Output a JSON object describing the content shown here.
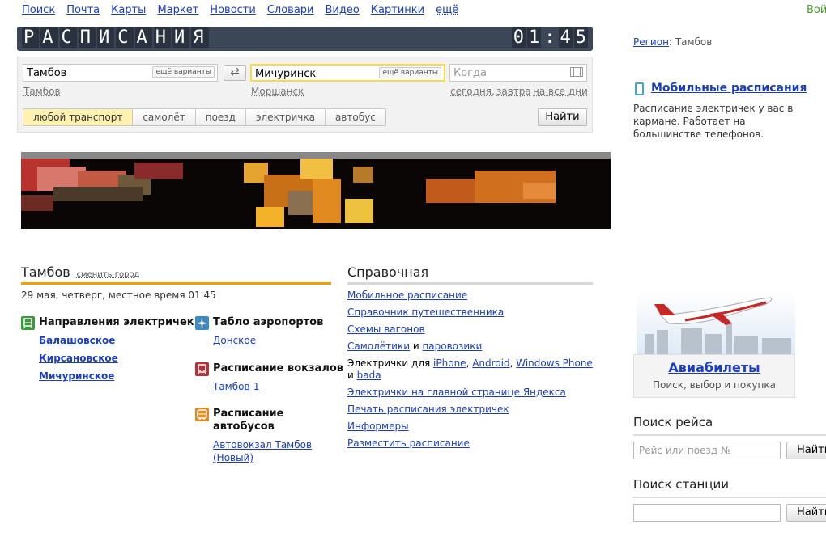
{
  "topnav": {
    "items": [
      "Поиск",
      "Почта",
      "Карты",
      "Маркет",
      "Новости",
      "Словари",
      "Видео",
      "Картинки"
    ],
    "more": "ещё",
    "login": "Вой"
  },
  "header": {
    "title": "РАСПИСАНИЯ",
    "clock": "01:45"
  },
  "form": {
    "from_value": "Тамбов",
    "to_value": "Мичуринск",
    "variants_label": "ещё варианты",
    "when_placeholder": "Когда",
    "from_hint": "Тамбов",
    "to_hint": "Моршанск",
    "date_hints": [
      "сегодня",
      "завтра",
      "на все дни"
    ],
    "transport_tabs": [
      "любой транспорт",
      "самолёт",
      "поезд",
      "электричка",
      "автобус"
    ],
    "find_button": "Найти"
  },
  "city": {
    "name": "Тамбов",
    "change_link": "сменить город",
    "date_line": "29 мая, четверг, местное время 01 45"
  },
  "sections": {
    "trains": {
      "title": "Направления электричек",
      "items": [
        "Балашовское",
        "Кирсановское",
        "Мичуринское"
      ]
    },
    "airports": {
      "title": "Табло аэропортов",
      "items": [
        "Донское"
      ]
    },
    "stations": {
      "title": "Расписание вокзалов",
      "items": [
        "Тамбов-1"
      ]
    },
    "buses": {
      "title_line1": "Расписание",
      "title_line2": "автобусов",
      "item_line1": "Автовокзал Тамбов",
      "item_line2": "(Новый)"
    }
  },
  "reference": {
    "title": "Справочная",
    "links": [
      "Мобильное расписание",
      "Справочник путешественника",
      "Схемы вагонов"
    ],
    "planes_and": {
      "a": "Самолётики",
      "and": " и ",
      "b": "паровозики"
    },
    "apps": {
      "prefix": "Электрички для ",
      "iphone": "iPhone",
      "android": "Android",
      "wp": "Windows Phone",
      "and": " и ",
      "bada": "bada"
    },
    "links2": [
      "Электрички на главной странице Яндекса",
      "Печать расписания электричек",
      "Информеры",
      "Разместить расписание"
    ]
  },
  "right": {
    "region_label": "Регион",
    "region_value": ": Тамбов",
    "mobile_title": "Мобильные расписания",
    "mobile_text": "Расписание электричек у вас в кармане. Работает на большинстве телефонов.",
    "avia_title": "Авиабилеты",
    "avia_sub": "Поиск, выбор и покупка",
    "trip_search_title": "Поиск рейса",
    "trip_search_placeholder": "Рейс или поезд №",
    "station_search_title": "Поиск станции",
    "find_button": "Найти"
  },
  "colors": {
    "link": "#1a3dc1",
    "header_bg": "#3b4657",
    "accent": "#f0a000"
  }
}
